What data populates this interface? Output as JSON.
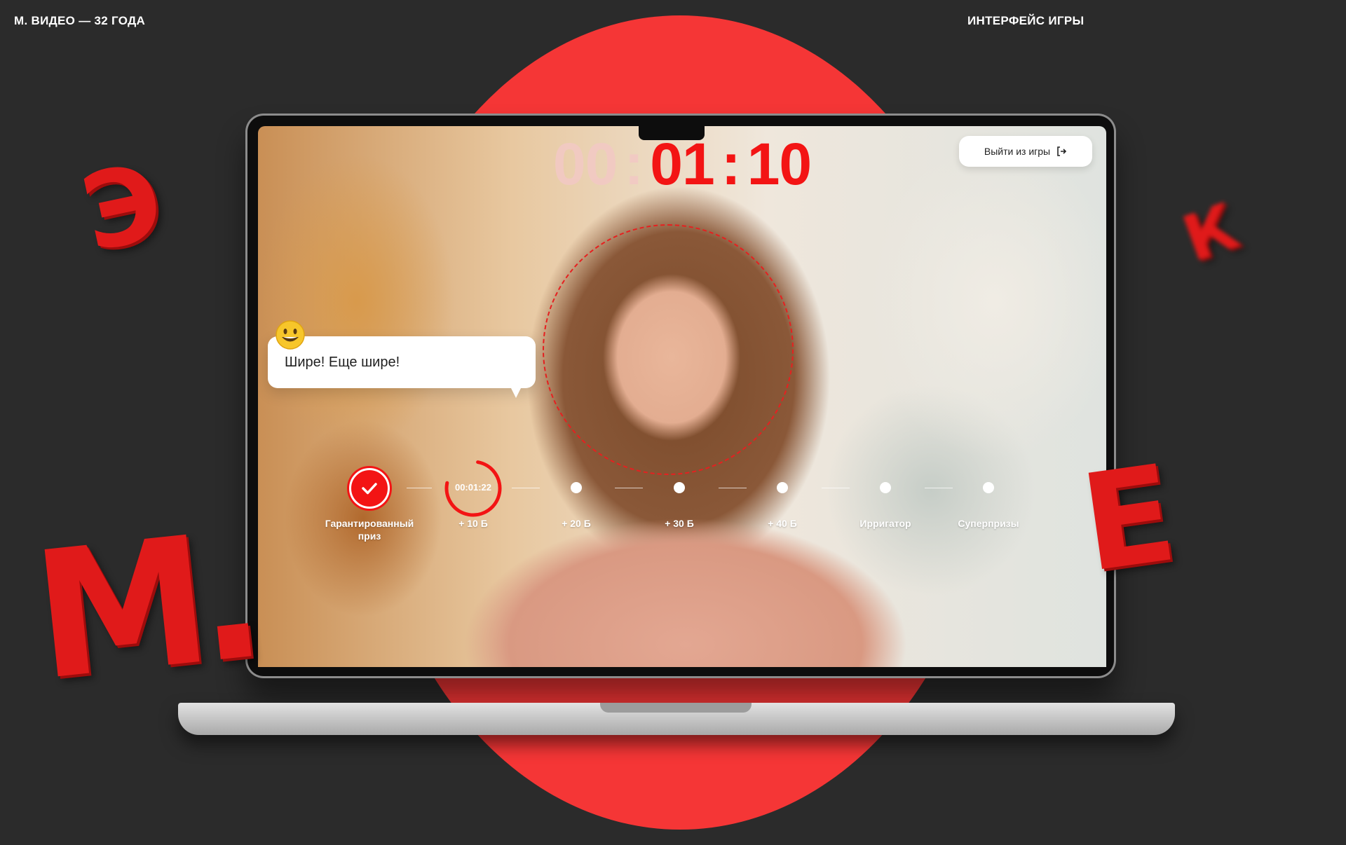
{
  "header": {
    "left_title": "М. ВИДЕО — 32 ГОДА",
    "right_title": "ИНТЕРФЕЙС ИГРЫ"
  },
  "decor": {
    "letter_e_left": "Э",
    "letter_k_right": "К",
    "letter_e_right": "Е",
    "logo_letters": "М."
  },
  "game": {
    "timer": {
      "hours": "00",
      "minutes": "01",
      "seconds": "10",
      "separator": ":"
    },
    "exit_button": "Выйти из игры",
    "hint_emoji": "😀",
    "hint_text": "Шире! Еще шире!",
    "steps": [
      {
        "label": "Гарантированный приз",
        "state": "done"
      },
      {
        "label": "+ 10 Б",
        "state": "active",
        "time": "00:01:22"
      },
      {
        "label": "+ 20 Б",
        "state": "pending"
      },
      {
        "label": "+ 30 Б",
        "state": "pending"
      },
      {
        "label": "+ 40 Б",
        "state": "pending"
      },
      {
        "label": "Ирригатор",
        "state": "pending"
      },
      {
        "label": "Суперпризы",
        "state": "pending"
      }
    ]
  },
  "colors": {
    "accent": "#f31414",
    "background": "#2b2b2b",
    "circle": "#f53636"
  }
}
